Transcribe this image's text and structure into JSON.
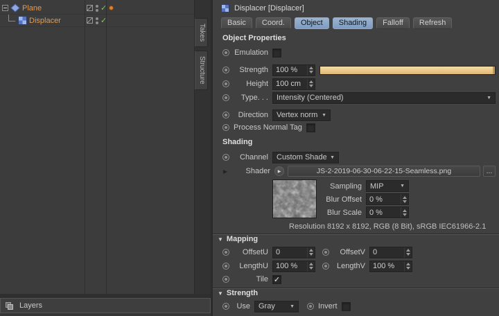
{
  "icons": {
    "check": "✓",
    "dropdown_arrow": "▼",
    "expand_arrow": "▶",
    "section_arrow": "▼",
    "more_button": "...",
    "shader_button_arrow": "▶"
  },
  "colors": {
    "tab_active": "#7e9cc2",
    "object_name": "#e29b4f",
    "enabled_check": "#83c45c",
    "slider_fill": "#e2b876",
    "tag_dot": "#e07f2e"
  },
  "object_manager": {
    "rows": [
      {
        "label": "Plane"
      },
      {
        "label": "Displacer"
      }
    ],
    "side_tabs": [
      {
        "label": "Takes"
      },
      {
        "label": "Structure"
      }
    ],
    "layers_label": "Layers"
  },
  "attributes": {
    "title": "Displacer [Displacer]",
    "tabs": [
      {
        "label": "Basic",
        "active": false
      },
      {
        "label": "Coord.",
        "active": false
      },
      {
        "label": "Object",
        "active": true
      },
      {
        "label": "Shading",
        "active": true
      },
      {
        "label": "Falloff",
        "active": false
      },
      {
        "label": "Refresh",
        "active": false
      }
    ],
    "object_properties": {
      "header": "Object Properties",
      "emulation_label": "Emulation",
      "strength_label": "Strength",
      "strength_value": "100 %",
      "strength_percent": 100,
      "height_label": "Height",
      "height_value": "100 cm",
      "type_label": "Type. . .",
      "type_value": "Intensity (Centered)",
      "direction_label": "Direction",
      "direction_value": "Vertex normal",
      "process_normal_tag_label": "Process Normal Tag"
    },
    "shading": {
      "header": "Shading",
      "channel_label": "Channel",
      "channel_value": "Custom Shader",
      "shader_label": "Shader",
      "shader_value": "JS-2-2019-06-30-06-22-15-Seamless.png",
      "sampling_label": "Sampling",
      "sampling_value": "MIP",
      "blur_offset_label": "Blur Offset",
      "blur_offset_value": "0 %",
      "blur_scale_label": "Blur Scale",
      "blur_scale_value": "0 %",
      "resolution": "Resolution 8192 x 8192, RGB (8 Bit), sRGB IEC61966-2.1"
    },
    "mapping": {
      "header": "Mapping",
      "offsetu_label": "OffsetU",
      "offsetu_value": "0",
      "offsetv_label": "OffsetV",
      "offsetv_value": "0",
      "lengthu_label": "LengthU",
      "lengthu_value": "100 %",
      "lengthv_label": "LengthV",
      "lengthv_value": "100 %",
      "tile_label": "Tile",
      "tile_checked": true
    },
    "strength": {
      "header": "Strength",
      "use_label": "Use",
      "use_value": "Gray",
      "invert_label": "Invert",
      "invert_checked": false
    }
  }
}
